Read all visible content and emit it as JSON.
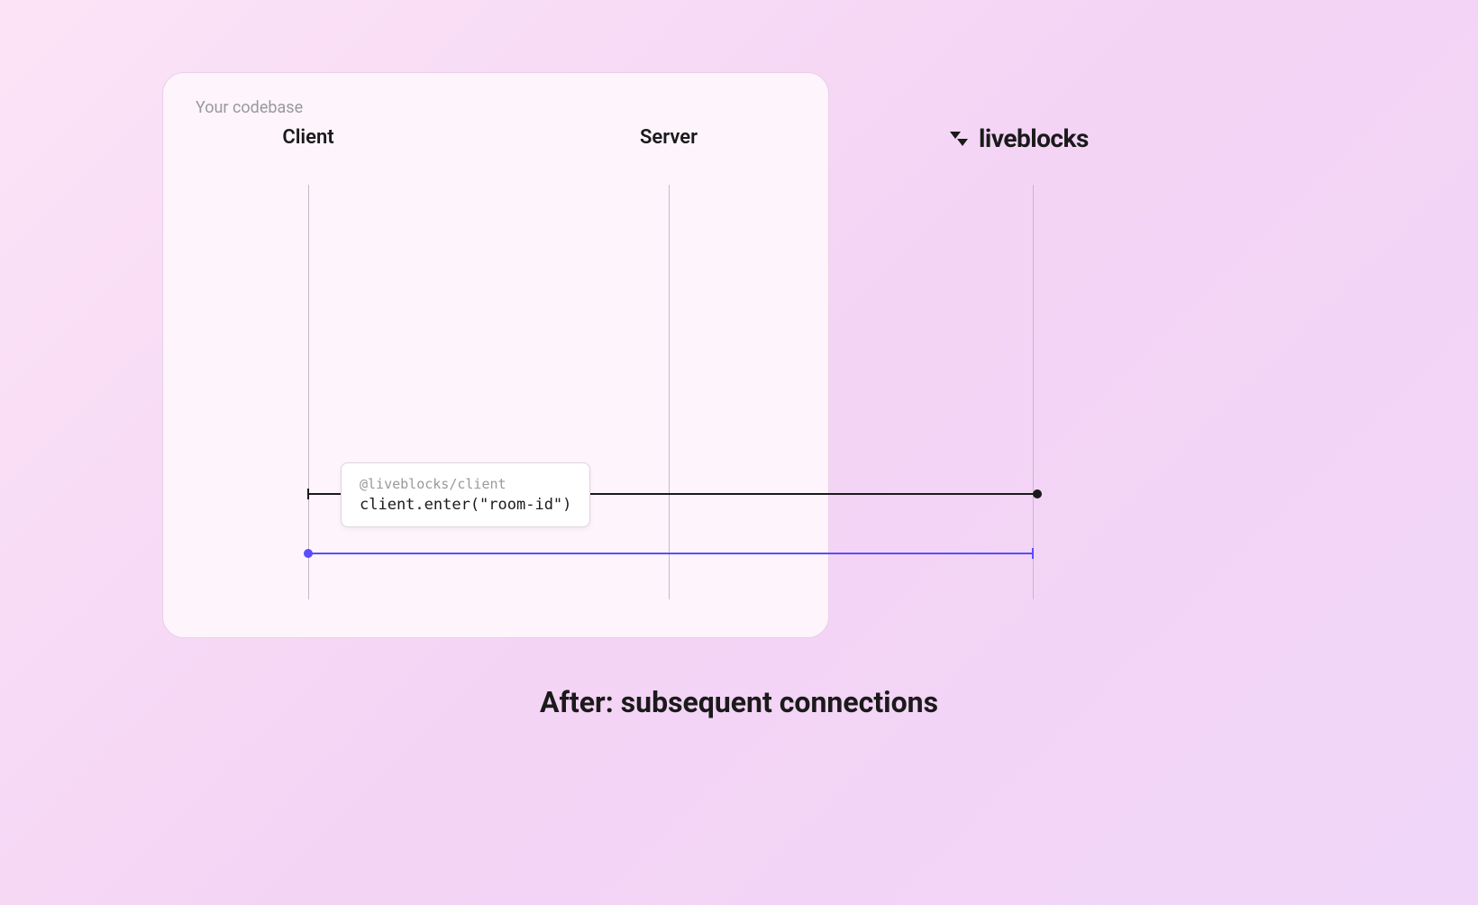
{
  "box": {
    "label": "Your codebase"
  },
  "columns": {
    "client": "Client",
    "server": "Server"
  },
  "brand": {
    "name": "liveblocks"
  },
  "code": {
    "package": "@liveblocks/client",
    "call": "client.enter(\"room-id\")"
  },
  "caption": "After: subsequent connections"
}
